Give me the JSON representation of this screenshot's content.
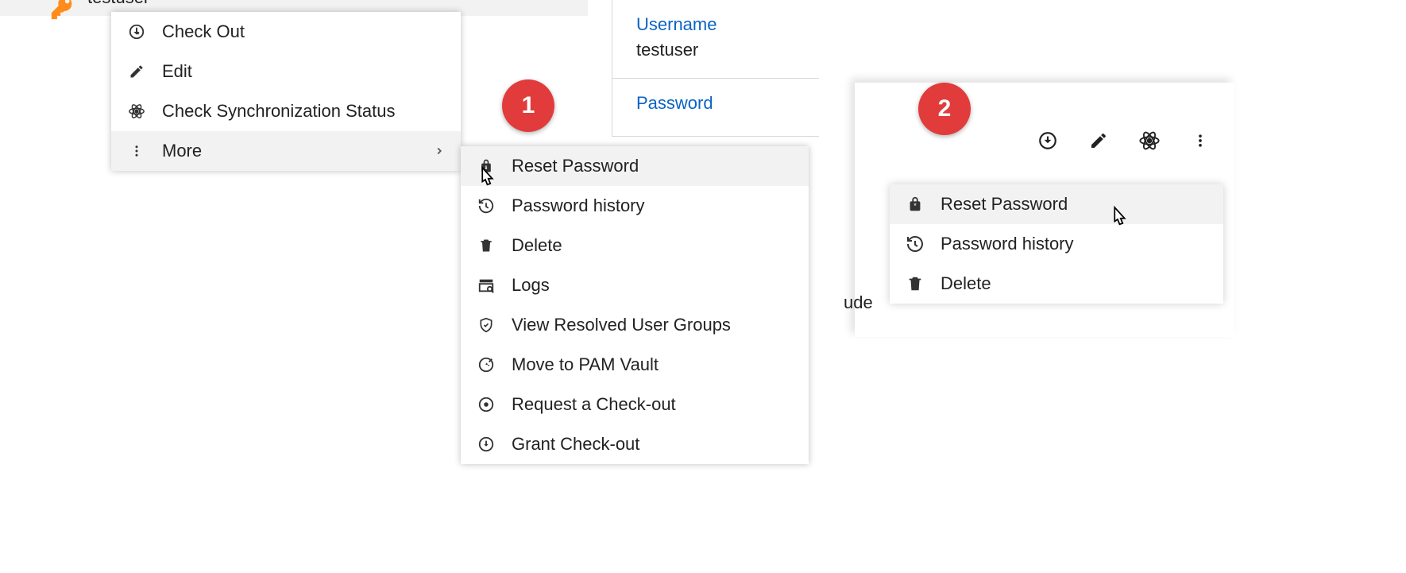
{
  "panel1": {
    "user": "testuser",
    "menu": {
      "check_out": "Check Out",
      "edit": "Edit",
      "sync": "Check Synchronization Status",
      "more": "More"
    },
    "submenu": {
      "reset_password": "Reset Password",
      "password_history": "Password history",
      "delete": "Delete",
      "logs": "Logs",
      "view_groups": "View Resolved User Groups",
      "move_vault": "Move to PAM Vault",
      "request_checkout": "Request a Check-out",
      "grant_checkout": "Grant Check-out"
    },
    "side": {
      "username_label": "Username",
      "username_value": "testuser",
      "password_label": "Password"
    }
  },
  "panel2": {
    "edge_text": "ude",
    "menu": {
      "reset_password": "Reset Password",
      "password_history": "Password history",
      "delete": "Delete"
    }
  },
  "steps": {
    "one": "1",
    "two": "2"
  }
}
